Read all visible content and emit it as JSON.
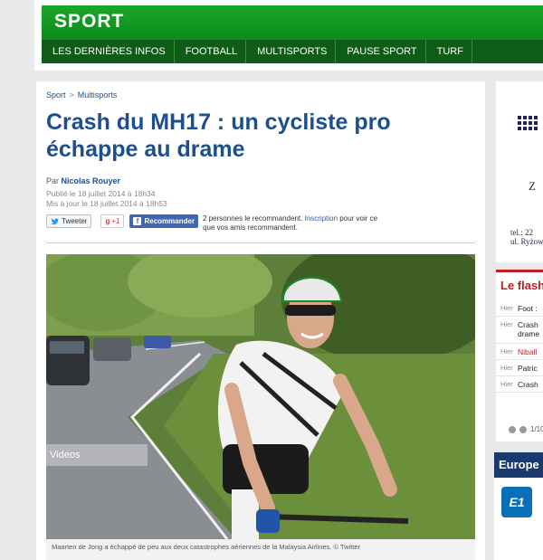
{
  "header": {
    "brand": "SPORT",
    "nav": [
      {
        "label": "LES DERNIÈRES INFOS"
      },
      {
        "label": "FOOTBALL"
      },
      {
        "label": "MULTISPORTS"
      },
      {
        "label": "PAUSE SPORT"
      },
      {
        "label": "TURF"
      }
    ]
  },
  "article": {
    "breadcrumb": {
      "root": "Sport",
      "separator": ">",
      "section": "Multisports"
    },
    "title": "Crash du MH17 : un cycliste pro échappe au drame",
    "byline_prefix": "Par",
    "author": "Nicolas Rouyer",
    "published": "Publié le 18 juillet 2014 à 18h34",
    "updated": "Mis à jour le 18 juillet 2014 à 18h53",
    "social": {
      "tweet": "Tweeter",
      "gplus": "+1",
      "facebook": "Recommander",
      "facebook_text": "2 personnes le recommandent.",
      "signup": "Inscription",
      "facebook_text_end": "pour voir ce que vos amis recommandent."
    },
    "videos_label": "Videos",
    "caption": "Maarten de Jong a échappé de peu aux deux catastrophes aériennes de la Malaysia Airlines. © Twitter"
  },
  "sidebar": {
    "ad": {
      "letter": "Z",
      "tel": "tel.: 22",
      "address": "ul. Ryżow"
    },
    "flash": {
      "title": "Le flash",
      "items": [
        {
          "when": "Hier",
          "what": "Foot :"
        },
        {
          "when": "Hier",
          "what": "Crash",
          "what2": "drame"
        },
        {
          "when": "Hier",
          "what": "Niball"
        },
        {
          "when": "Hier",
          "what": "Patric"
        },
        {
          "when": "Hier",
          "what": "Crash"
        }
      ],
      "pager": "1/10"
    },
    "europe": {
      "title": "Europe",
      "logo": "E1"
    }
  },
  "colors": {
    "brand_green": "#19a82a",
    "nav_dark": "#0f5c17",
    "title_blue": "#1d4f8c",
    "flash_red": "#c41b20"
  }
}
